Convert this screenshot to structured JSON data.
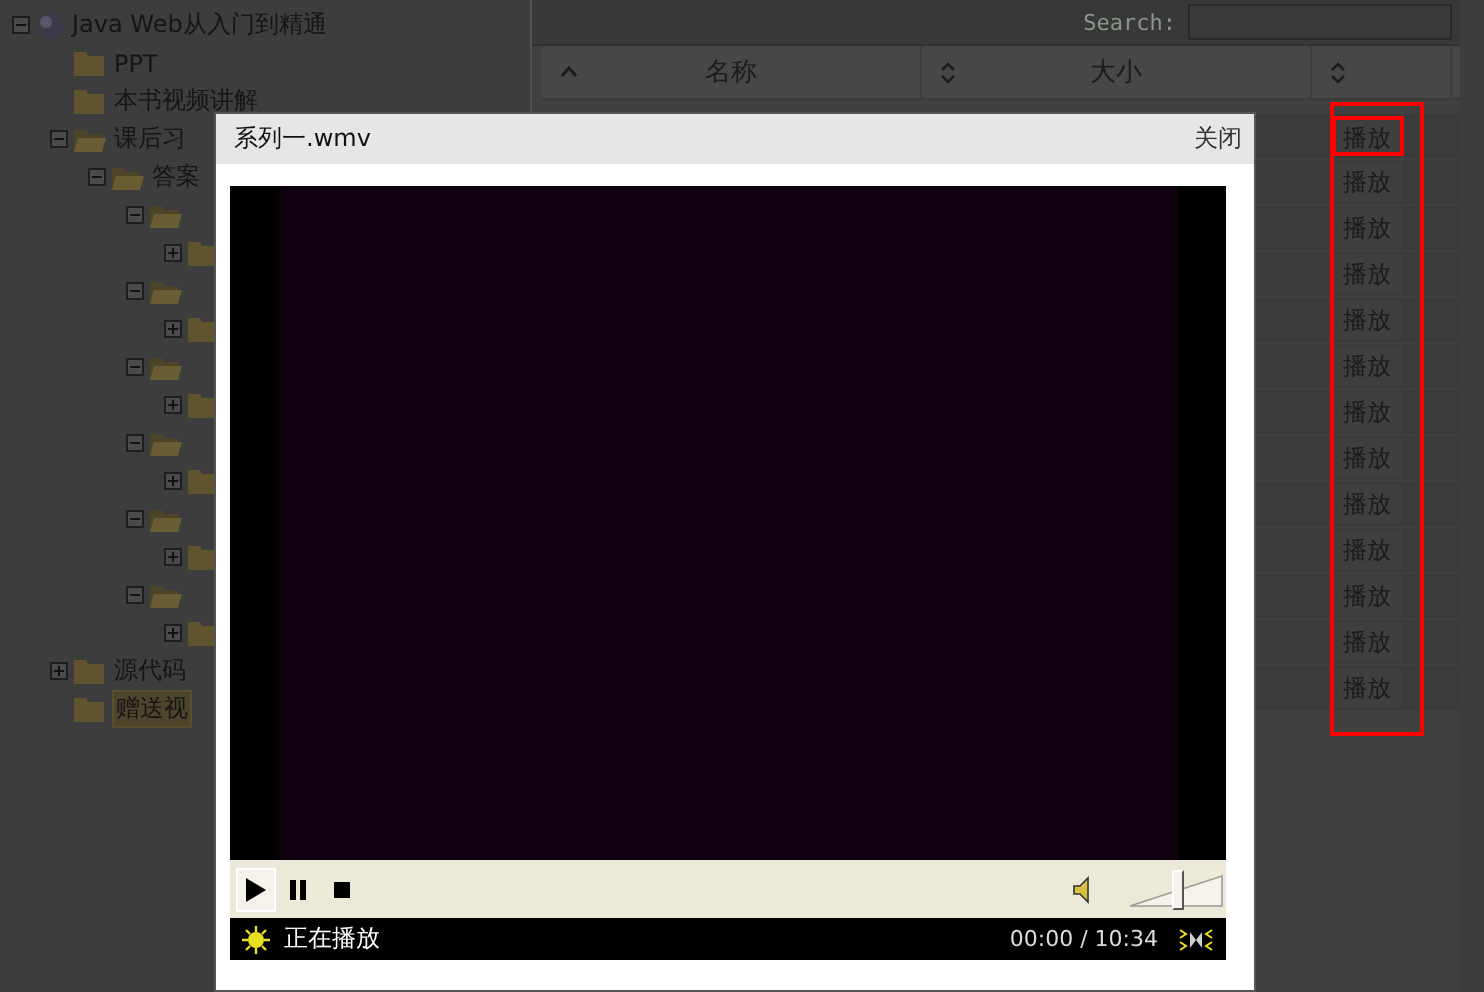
{
  "tree": [
    {
      "kind": "globe",
      "label": "Java Web从入门到精通",
      "expanded": true,
      "selected": false,
      "children": [
        {
          "kind": "folder",
          "label": "PPT",
          "selected": false
        },
        {
          "kind": "folder",
          "label": "本书视频讲解",
          "selected": false
        },
        {
          "kind": "folder",
          "label": "课后习",
          "expanded": true,
          "selected": false,
          "children": [
            {
              "kind": "folder",
              "label": "答案",
              "expanded": true,
              "selected": false,
              "children": [
                {
                  "kind": "folder",
                  "expanded": true,
                  "children": [
                    {
                      "kind": "folder",
                      "expanded": false
                    }
                  ]
                },
                {
                  "kind": "folder",
                  "expanded": true,
                  "children": [
                    {
                      "kind": "folder",
                      "expanded": false
                    }
                  ]
                },
                {
                  "kind": "folder",
                  "expanded": true,
                  "children": [
                    {
                      "kind": "folder",
                      "expanded": false
                    }
                  ]
                },
                {
                  "kind": "folder",
                  "expanded": true,
                  "children": [
                    {
                      "kind": "folder",
                      "expanded": false
                    }
                  ]
                },
                {
                  "kind": "folder",
                  "expanded": true,
                  "children": [
                    {
                      "kind": "folder",
                      "expanded": false
                    }
                  ]
                },
                {
                  "kind": "folder",
                  "expanded": true,
                  "children": [
                    {
                      "kind": "folder",
                      "expanded": false
                    }
                  ]
                }
              ]
            }
          ]
        },
        {
          "kind": "folder",
          "label": "源代码",
          "expanded": false,
          "selected": false
        },
        {
          "kind": "folder",
          "label": "赠送视",
          "selected": true
        }
      ]
    }
  ],
  "table": {
    "search": {
      "label": "Search:"
    },
    "columns": [
      {
        "label": "名称",
        "sorted": true
      },
      {
        "label": "大小",
        "sorted": false
      },
      {
        "sorted": false
      }
    ],
    "outlined": true,
    "rows": [
      {
        "action": "播放",
        "highlighted": true
      },
      {
        "action": "播放",
        "highlighted": false
      },
      {
        "action": "播放",
        "highlighted": false
      },
      {
        "action": "播放",
        "highlighted": false
      },
      {
        "action": "播放",
        "highlighted": false
      },
      {
        "action": "播放",
        "highlighted": false
      },
      {
        "action": "播放",
        "highlighted": false
      },
      {
        "action": "播放",
        "highlighted": false
      },
      {
        "action": "播放",
        "highlighted": false
      },
      {
        "action": "播放",
        "highlighted": false
      },
      {
        "action": "播放",
        "highlighted": false
      },
      {
        "action": "播放",
        "highlighted": false
      },
      {
        "action": "播放",
        "highlighted": false
      }
    ]
  },
  "player": {
    "title": "系列一.wmv",
    "close": "关闭",
    "controls": [
      {
        "kind": "play",
        "selected": true
      },
      {
        "kind": "pause",
        "selected": false
      },
      {
        "kind": "stop",
        "selected": false
      }
    ],
    "volume": {
      "level": 0.5
    },
    "status": "正在播放",
    "time": "00:00 / 10:34"
  }
}
